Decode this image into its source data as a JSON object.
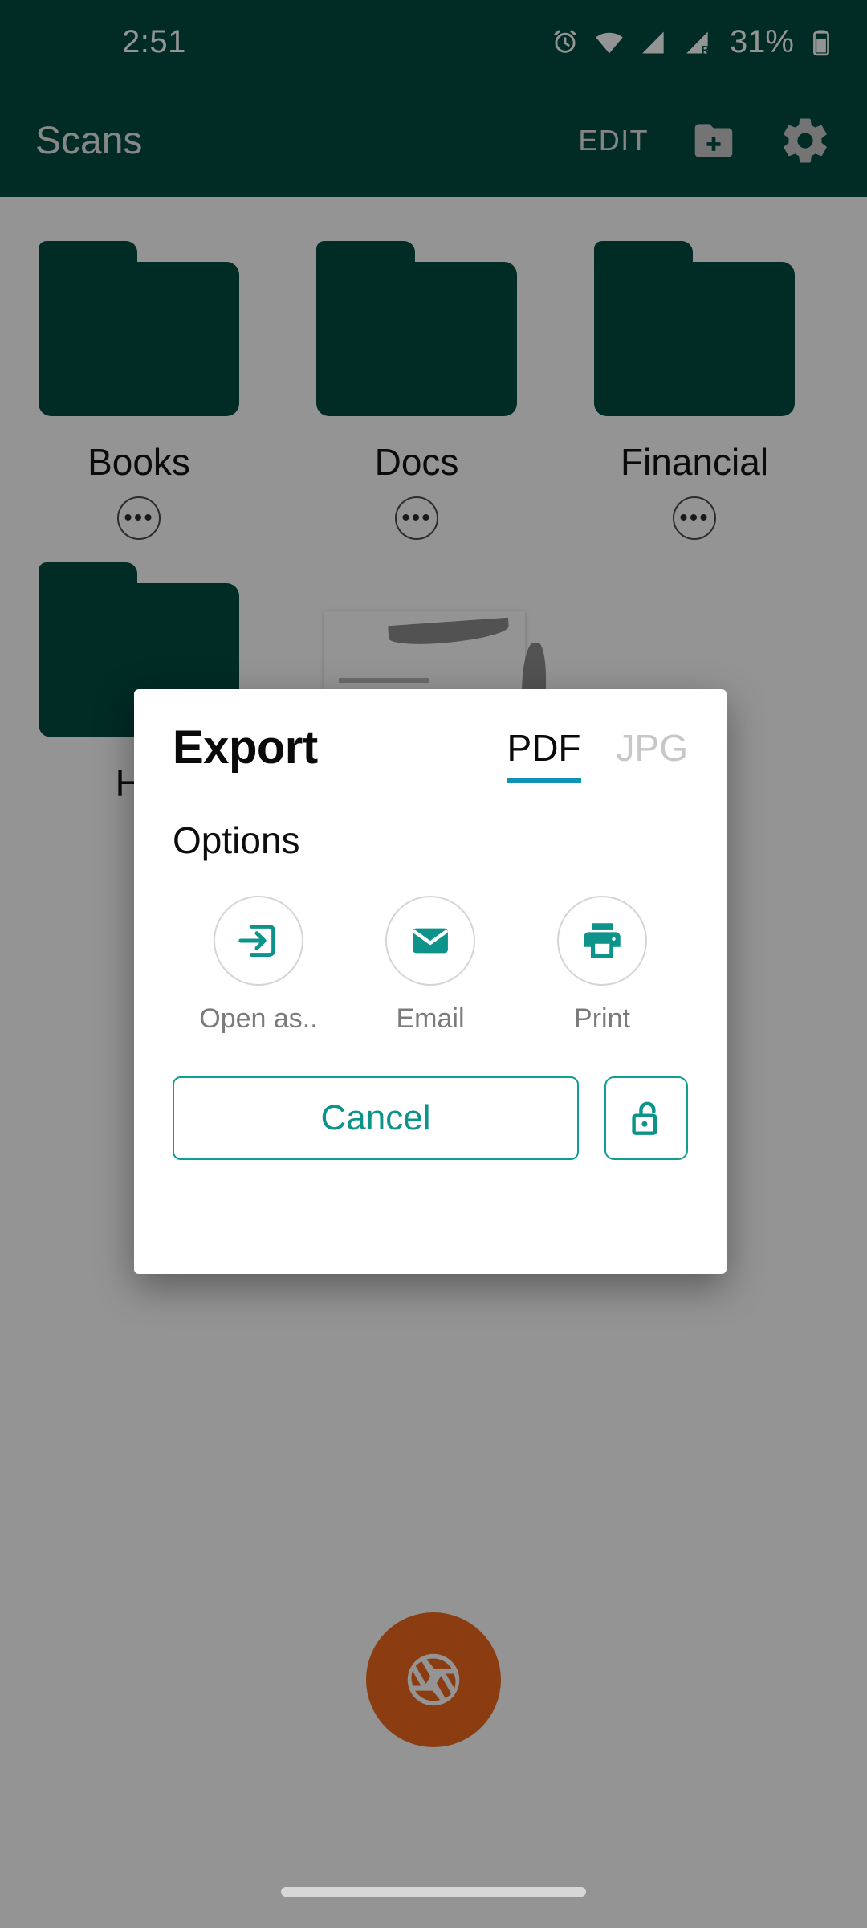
{
  "statusbar": {
    "time": "2:51",
    "battery_percent": "31%",
    "icons": [
      "alarm-icon",
      "wifi-icon",
      "signal-icon",
      "signal-roaming-icon",
      "battery-icon"
    ]
  },
  "appbar": {
    "title": "Scans",
    "edit_label": "EDIT",
    "new_folder_icon": "new-folder-icon",
    "settings_icon": "gear-icon",
    "background_color": "#034A41"
  },
  "content": {
    "folders_row1": [
      {
        "name": "Books",
        "more_label": "•••"
      },
      {
        "name": "Docs",
        "more_label": "•••"
      },
      {
        "name": "Financial",
        "more_label": "•••"
      }
    ],
    "folders_row2": [
      {
        "name": "Ho",
        "more_label": "•••"
      }
    ],
    "fab_icon": "camera-aperture-icon",
    "fab_color": "#F06A1E"
  },
  "dialog": {
    "title": "Export",
    "format_tabs": [
      {
        "label": "PDF",
        "selected": true
      },
      {
        "label": "JPG",
        "selected": false
      }
    ],
    "options_label": "Options",
    "options": [
      {
        "label": "Open as..",
        "icon": "open-in-icon"
      },
      {
        "label": "Email",
        "icon": "email-icon"
      },
      {
        "label": "Print",
        "icon": "print-icon"
      }
    ],
    "cancel_label": "Cancel",
    "lock_icon": "unlock-icon",
    "accent_color": "#0D9389",
    "tab_underline_color": "#1190B8"
  },
  "navbar": {
    "pill": "gesture-nav-pill"
  }
}
